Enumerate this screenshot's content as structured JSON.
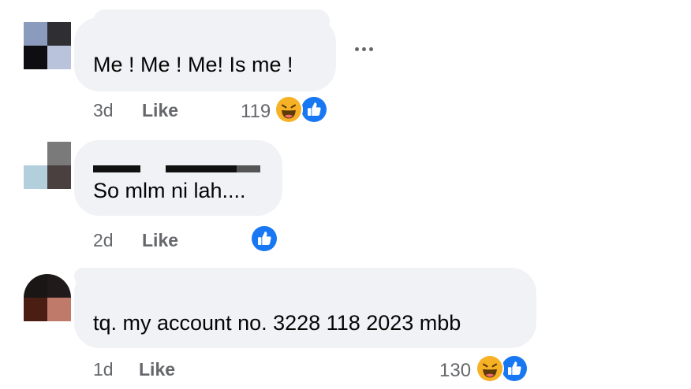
{
  "comments": [
    {
      "text": "Me ! Me ! Me! Is me !",
      "time": "3d",
      "like_label": "Like",
      "reaction_count": "119",
      "reactions": [
        "haha-icon",
        "like-icon"
      ]
    },
    {
      "text": "So mlm ni lah....",
      "time": "2d",
      "like_label": "Like",
      "reaction_count": "",
      "reactions": [
        "like-icon"
      ]
    },
    {
      "text": "tq. my account no. 3228 118 2023 mbb",
      "time": "1d",
      "like_label": "Like",
      "reaction_count": "130",
      "reactions": [
        "haha-icon",
        "like-icon"
      ]
    }
  ],
  "more_options_icon": "ellipsis-icon",
  "colors": {
    "bubble": "#f0f2f5",
    "meta_text": "#65676b",
    "like_blue": "#1877f2",
    "haha_yellow": "#f7b125"
  }
}
